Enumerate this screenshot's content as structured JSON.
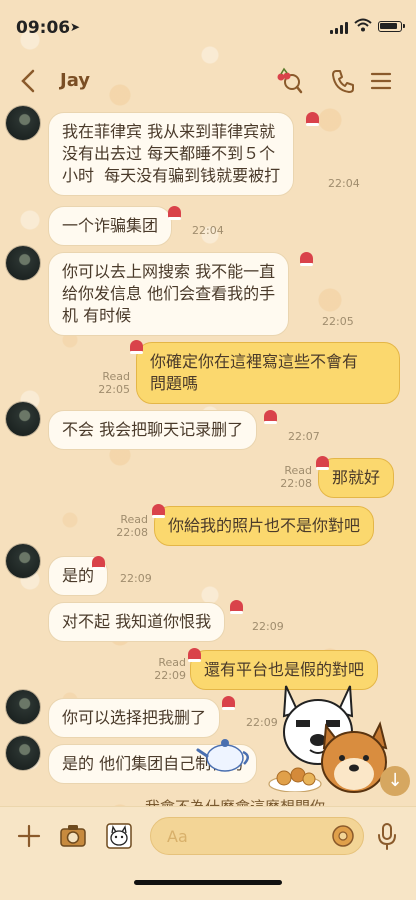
{
  "status_bar": {
    "time": "09:06"
  },
  "header": {
    "title": "Jay"
  },
  "messages": [
    {
      "side": "in",
      "avatar": true,
      "text": "我在菲律宾 我从来到菲律宾就\n没有出去过 每天都睡不到５个\n小时  每天没有骗到钱就要被打",
      "time": "22:04"
    },
    {
      "side": "in",
      "avatar": false,
      "text": "一个诈骗集团",
      "time": "22:04"
    },
    {
      "side": "in",
      "avatar": true,
      "text": "你可以去上网搜索 我不能一直\n给你发信息 他们会查看我的手\n机 有时候",
      "time": "22:05"
    },
    {
      "side": "out",
      "text": "你確定你在這裡寫這些不會有\n問題嗎",
      "read": "Read",
      "time": "22:05"
    },
    {
      "side": "in",
      "avatar": true,
      "text": "不会 我会把聊天记录删了",
      "time": "22:07"
    },
    {
      "side": "out",
      "text": "那就好",
      "read": "Read",
      "time": "22:08"
    },
    {
      "side": "out",
      "text": "你給我的照片也不是你對吧",
      "read": "Read",
      "time": "22:08"
    },
    {
      "side": "in",
      "avatar": true,
      "text": "是的",
      "time": "22:09"
    },
    {
      "side": "in",
      "avatar": false,
      "text": "对不起 我知道你恨我",
      "time": "22:09"
    },
    {
      "side": "out",
      "text": "還有平台也是假的對吧",
      "read": "Read",
      "time": "22:09"
    },
    {
      "side": "in",
      "avatar": true,
      "text": "你可以选择把我删了",
      "time": "22:09"
    },
    {
      "side": "in",
      "avatar": true,
      "text": "是的 他们集团自己制作的",
      "time": ""
    },
    {
      "side": "out",
      "text": "我會不為什麼會這麼想問你",
      "read": "",
      "time": ""
    }
  ],
  "input": {
    "placeholder": "Aa"
  },
  "colors": {
    "incoming": "#fffaf0",
    "outgoing": "#fbd86e",
    "background": "#f6e0bd",
    "title": "#7a4e24"
  },
  "icons": [
    "back-chevron-icon",
    "search-icon",
    "phone-icon",
    "menu-icon",
    "plus-icon",
    "camera-icon",
    "sticker-icon",
    "emoji-icon",
    "mic-icon",
    "scroll-down-icon"
  ]
}
